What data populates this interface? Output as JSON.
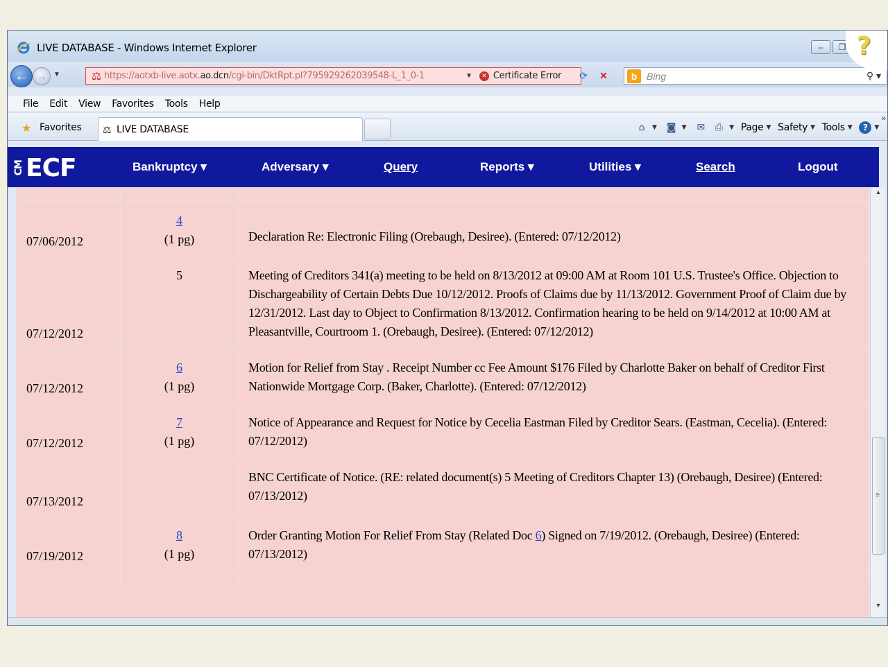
{
  "window": {
    "title": "LIVE DATABASE - Windows Internet Explorer",
    "buttons": {
      "minimize": "–",
      "restore": "❐",
      "close": "✕"
    }
  },
  "address_bar": {
    "url_prefix": "https://aotxb-live.aotx.",
    "url_host": "ao.dcn",
    "url_suffix": "/cgi-bin/DktRpt.pl?795929262039548-L_1_0-1",
    "cert_error": "Certificate Error",
    "search_placeholder": "Bing"
  },
  "menu": [
    "File",
    "Edit",
    "View",
    "Favorites",
    "Tools",
    "Help"
  ],
  "favorites_bar": {
    "favorites_label": "Favorites",
    "tab_label": "LIVE DATABASE",
    "commands": {
      "page": "Page",
      "safety": "Safety",
      "tools": "Tools"
    }
  },
  "ecf": {
    "logo_cm": "CM",
    "logo_main": "ECF",
    "nav": {
      "bankruptcy": "Bankruptcy ▾",
      "adversary": "Adversary ▾",
      "query": "Query",
      "reports": "Reports ▾",
      "utilities": "Utilities ▾",
      "search": "Search",
      "logout": "Logout"
    }
  },
  "docket": {
    "rows": [
      {
        "date": "07/06/2012",
        "num": "4",
        "pages": "(1 pg)",
        "text": "Declaration Re: Electronic Filing (Orebaugh, Desiree). (Entered: 07/12/2012)"
      },
      {
        "date": "07/12/2012",
        "num": "5",
        "pages": "",
        "text": "Meeting of Creditors 341(a) meeting to be held on 8/13/2012 at 09:00 AM at Room 101 U.S. Trustee's Office. Objection to Dischargeability of Certain Debts Due 10/12/2012. Proofs of Claims due by 11/13/2012. Government Proof of Claim due by 12/31/2012. Last day to Object to Confirmation 8/13/2012. Confirmation hearing to be held on 9/14/2012 at 10:00 AM at Pleasantville, Courtroom 1. (Orebaugh, Desiree). (Entered: 07/12/2012)"
      },
      {
        "date": "07/12/2012",
        "num": "6",
        "pages": "(1 pg)",
        "text": "Motion for Relief from Stay . Receipt Number cc Fee Amount $176 Filed by Charlotte Baker on behalf of Creditor First Nationwide Mortgage Corp. (Baker, Charlotte). (Entered: 07/12/2012)"
      },
      {
        "date": "07/12/2012",
        "num": "7",
        "pages": "(1 pg)",
        "text": "Notice of Appearance and Request for Notice by Cecelia Eastman Filed by Creditor Sears. (Eastman, Cecelia). (Entered: 07/12/2012)"
      },
      {
        "date": "07/13/2012",
        "num": "",
        "pages": "",
        "text": "BNC Certificate of Notice. (RE: related document(s) 5 Meeting of Creditors Chapter 13) (Orebaugh, Desiree) (Entered: 07/13/2012)"
      },
      {
        "date": "07/19/2012",
        "num": "8",
        "pages": "(1 pg)",
        "text_before": "Order Granting Motion For Relief From Stay (Related Doc ",
        "text_link": "6",
        "text_after": ") Signed on 7/19/2012. (Orebaugh, Desiree) (Entered: 07/13/2012)"
      }
    ]
  }
}
